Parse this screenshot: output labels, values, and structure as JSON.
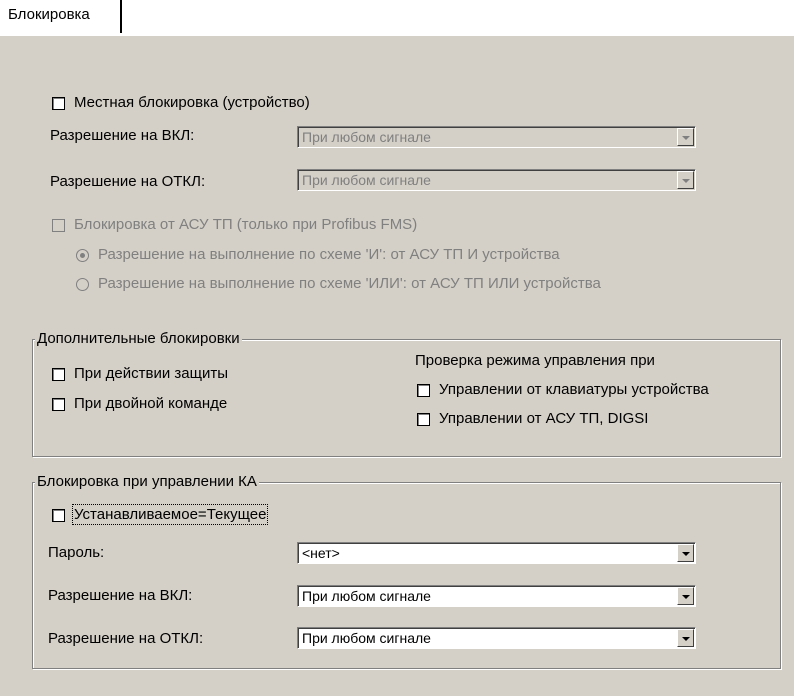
{
  "tab": {
    "label": "Блокировка"
  },
  "local": {
    "checkbox_label": "Местная блокировка (устройство)",
    "on_label": "Разрешение на ВКЛ:",
    "on_value": "При любом сигнале",
    "off_label": "Разрешение на ОТКЛ:",
    "off_value": "При любом сигнале"
  },
  "scada": {
    "checkbox_label": "Блокировка от АСУ ТП (только при Profibus FMS)",
    "radio_and": "Разрешение на выполнение по схеме 'И': от АСУ ТП И устройства",
    "radio_or": "Разрешение на выполнение по схеме 'ИЛИ': от АСУ ТП ИЛИ устройства"
  },
  "extra": {
    "title": "Дополнительные блокировки",
    "protection": "При действии защиты",
    "double_cmd": "При двойной команде",
    "mode_title": "Проверка режима управления при",
    "keyboard": "Управлении от клавиатуры устройства",
    "scada_digsi": "Управлении от АСУ ТП, DIGSI"
  },
  "ka": {
    "title": "Блокировка при управлении КА",
    "set_eq_current": "Устанавливаемое=Текущее",
    "password_label": "Пароль:",
    "password_value": "<нет>",
    "on_label": "Разрешение на ВКЛ:",
    "on_value": "При любом сигнале",
    "off_label": "Разрешение на ОТКЛ:",
    "off_value": "При любом сигнале"
  }
}
